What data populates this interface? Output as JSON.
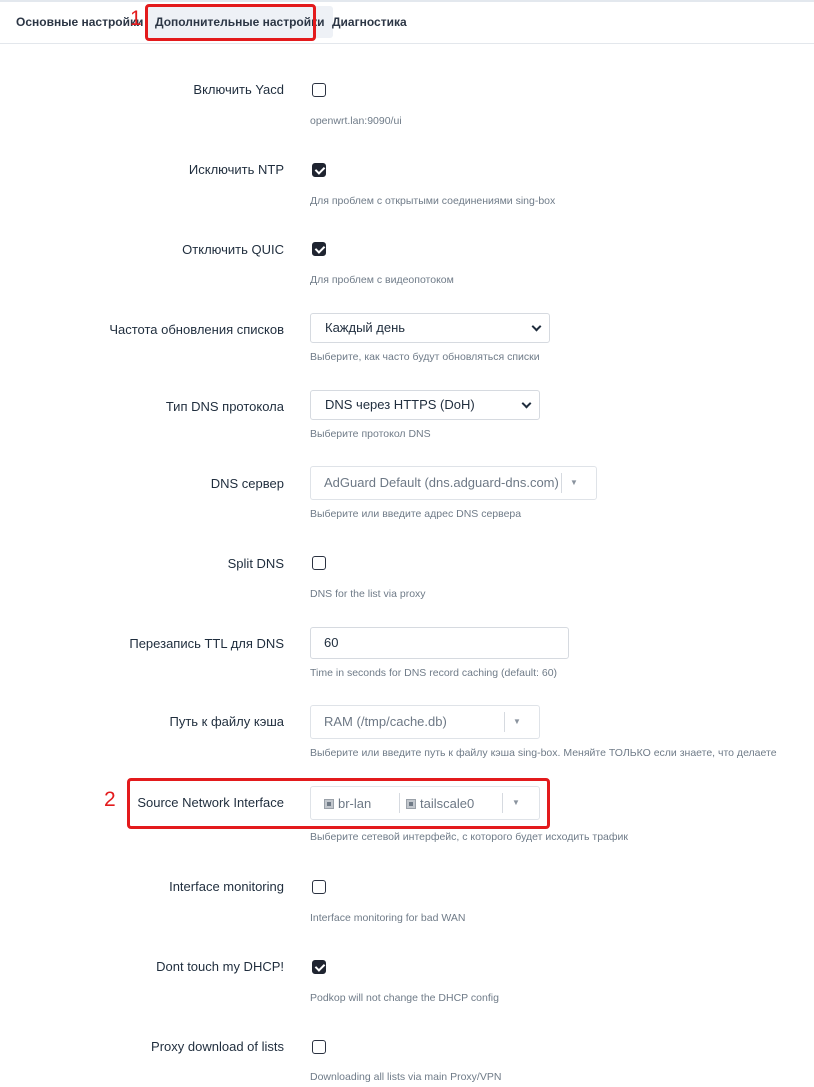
{
  "tabs": [
    {
      "label": "Основные настройки",
      "active": false
    },
    {
      "label": "Дополнительные настройки",
      "active": true
    },
    {
      "label": "Диагностика",
      "active": false
    }
  ],
  "annotations": {
    "marker_1": "1",
    "marker_2": "2"
  },
  "fields": {
    "yacd": {
      "label": "Включить Yacd",
      "checked": false,
      "help": "openwrt.lan:9090/ui"
    },
    "exclude_ntp": {
      "label": "Исключить NTP",
      "checked": true,
      "help": "Для проблем с открытыми соединениями sing-box"
    },
    "disable_quic": {
      "label": "Отключить QUIC",
      "checked": true,
      "help": "Для проблем с видеопотоком"
    },
    "update_interval": {
      "label": "Частота обновления списков",
      "value": "Каждый день",
      "help": "Выберите, как часто будут обновляться списки"
    },
    "dns_type": {
      "label": "Тип DNS протокола",
      "value": "DNS через HTTPS (DoH)",
      "help": "Выберите протокол DNS"
    },
    "dns_server": {
      "label": "DNS сервер",
      "value": "AdGuard Default (dns.adguard-dns.com)",
      "help": "Выберите или введите адрес DNS сервера"
    },
    "split_dns": {
      "label": "Split DNS",
      "checked": false,
      "help": "DNS for the list via proxy"
    },
    "dns_ttl": {
      "label": "Перезапись TTL для DNS",
      "value": "60",
      "help": "Time in seconds for DNS record caching (default: 60)"
    },
    "cache_path": {
      "label": "Путь к файлу кэша",
      "value": "RAM (/tmp/cache.db)",
      "help": "Выберите или введите путь к файлу кэша sing-box. Меняйте ТОЛЬКО если знаете, что делаете"
    },
    "source_iface": {
      "label": "Source Network Interface",
      "chips": [
        "br-lan",
        "tailscale0"
      ],
      "help": "Выберите сетевой интерфейс, с которого будет исходить трафик"
    },
    "iface_monitoring": {
      "label": "Interface monitoring",
      "checked": false,
      "help": "Interface monitoring for bad WAN"
    },
    "dont_touch_dhcp": {
      "label": "Dont touch my DHCP!",
      "checked": true,
      "help": "Podkop will not change the DHCP config"
    },
    "proxy_download": {
      "label": "Proxy download of lists",
      "checked": false,
      "help": "Downloading all lists via main Proxy/VPN"
    }
  },
  "colors": {
    "accent_red": "#e31a1c",
    "checkbox_dark": "#1f2430"
  }
}
